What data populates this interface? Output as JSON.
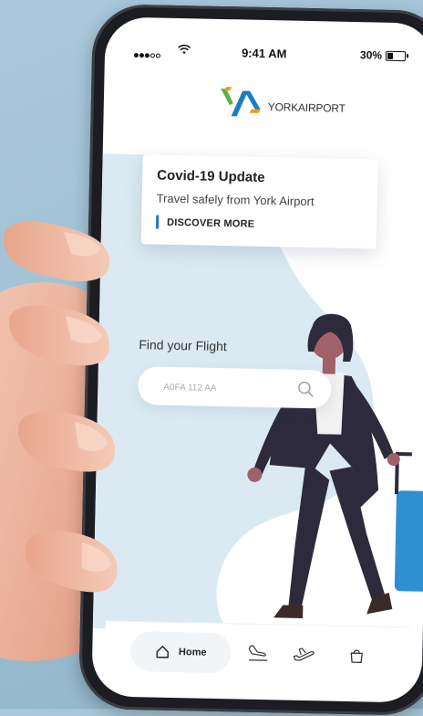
{
  "status_bar": {
    "time": "9:41 AM",
    "battery": "30%"
  },
  "brand": {
    "name": "YORKAIRPORT",
    "colors": {
      "green": "#5cb33f",
      "blue": "#1d7bc4",
      "orange": "#f39a1e"
    }
  },
  "announcement": {
    "title": "Covid-19 Update",
    "subtitle": "Travel safely from York Airport",
    "cta": "DISCOVER MORE",
    "accent": "#1d7bc4"
  },
  "flight_search": {
    "label": "Find your Flight",
    "placeholder": "A0FA 112 AA"
  },
  "tab_bar": {
    "items": [
      {
        "id": "home",
        "label": "Home",
        "icon": "home-icon"
      },
      {
        "id": "arrivals",
        "icon": "plane-arrival-icon"
      },
      {
        "id": "departures",
        "icon": "plane-departure-icon"
      },
      {
        "id": "shop",
        "icon": "shopping-bag-icon"
      }
    ]
  }
}
